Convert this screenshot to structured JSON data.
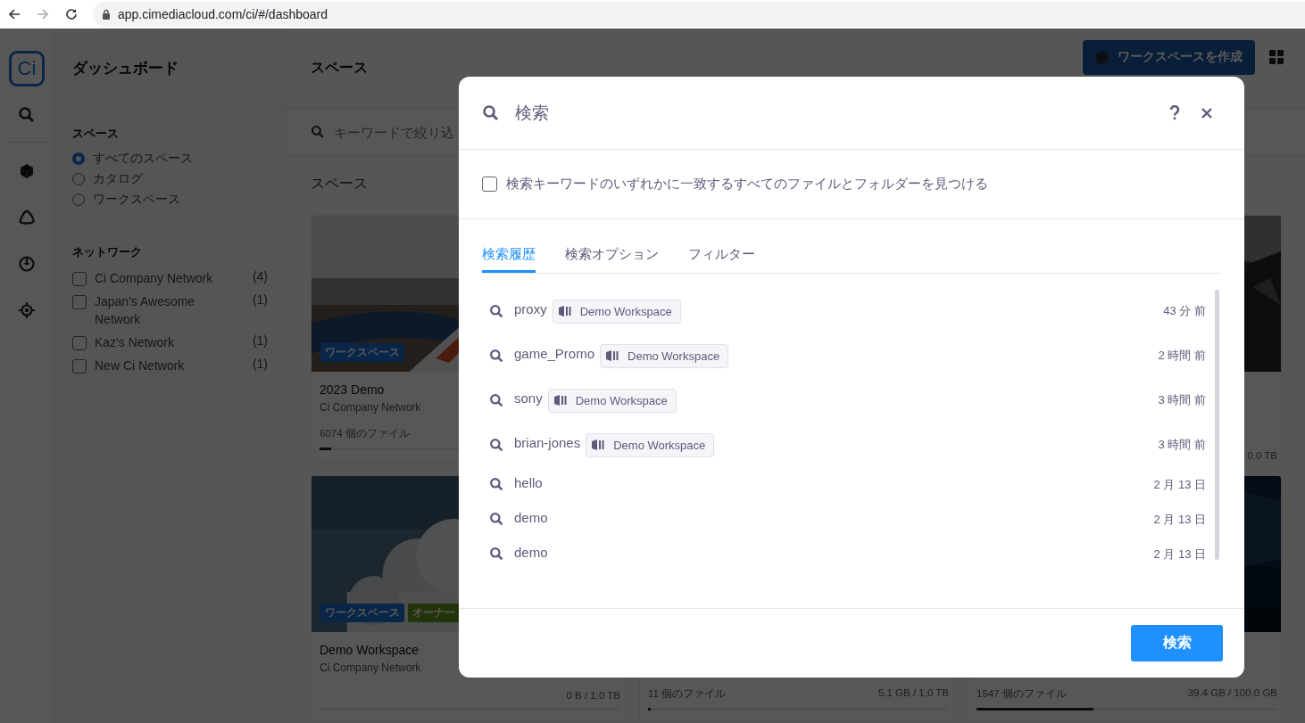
{
  "browser": {
    "url": "app.cimediacloud.com/ci/#/dashboard"
  },
  "rail": {
    "logo": "Ci"
  },
  "sidebar": {
    "title": "ダッシュボード",
    "spaces": {
      "heading": "スペース",
      "options": [
        {
          "label": "すべてのスペース",
          "selected": true
        },
        {
          "label": "カタログ",
          "selected": false
        },
        {
          "label": "ワークスペース",
          "selected": false
        }
      ]
    },
    "networks": {
      "heading": "ネットワーク",
      "items": [
        {
          "label": "Ci Company Network",
          "count": "(4)",
          "checked": false
        },
        {
          "label": "Japan's Awesome Network",
          "count": "(1)",
          "checked": false
        },
        {
          "label": "Kaz's Network",
          "count": "(1)",
          "checked": false
        },
        {
          "label": "New Ci Network",
          "count": "(1)",
          "checked": false
        }
      ]
    }
  },
  "main": {
    "title": "スペース",
    "create_button": "ワークスペースを作成",
    "filter": {
      "placeholder": "キーワードで絞り込"
    },
    "section_label": "スペース",
    "cards": [
      {
        "title": "2023 Demo",
        "network": "Ci Company Network",
        "badges": [
          {
            "label": "ワークスペース",
            "kind": "workspace"
          }
        ],
        "files": "6074 個のファイル",
        "level": 0.04
      },
      {
        "storage": "0.0 TB"
      },
      {
        "title": "Demo Workspace",
        "network": "Ci Company Network",
        "badges": [
          {
            "label": "ワークスペース",
            "kind": "workspace"
          },
          {
            "label": "オーナー",
            "kind": "owner"
          }
        ],
        "storage": "0 B / 1.0 TB",
        "level": 0
      },
      {
        "files": "11 個のファイル",
        "storage": "5.1 GB / 1.0 TB",
        "level": 0.01
      },
      {
        "files": "1547 個のファイル",
        "storage": "39.4 GB / 100.0 GB",
        "level": 0.39
      }
    ]
  },
  "modal": {
    "search": {
      "placeholder": "検索"
    },
    "match_any": {
      "label": "検索キーワードのいずれかに一致するすべてのファイルとフォルダーを見つける",
      "checked": false
    },
    "tabs": [
      {
        "label": "検索履歴",
        "selected": true
      },
      {
        "label": "検索オプション",
        "selected": false
      },
      {
        "label": "フィルター",
        "selected": false
      }
    ],
    "history": [
      {
        "query": "proxy",
        "workspace": "Demo Workspace",
        "time": "43 分 前"
      },
      {
        "query": "game_Promo",
        "workspace": "Demo Workspace",
        "time": "2 時間 前"
      },
      {
        "query": "sony",
        "workspace": "Demo Workspace",
        "time": "3 時間 前"
      },
      {
        "query": "brian-jones",
        "workspace": "Demo Workspace",
        "time": "3 時間 前"
      },
      {
        "query": "hello",
        "time": "2 月 13 日"
      },
      {
        "query": "demo",
        "time": "2 月 13 日"
      },
      {
        "query": "demo",
        "time": "2 月 13 日"
      }
    ],
    "submit": "検索"
  }
}
